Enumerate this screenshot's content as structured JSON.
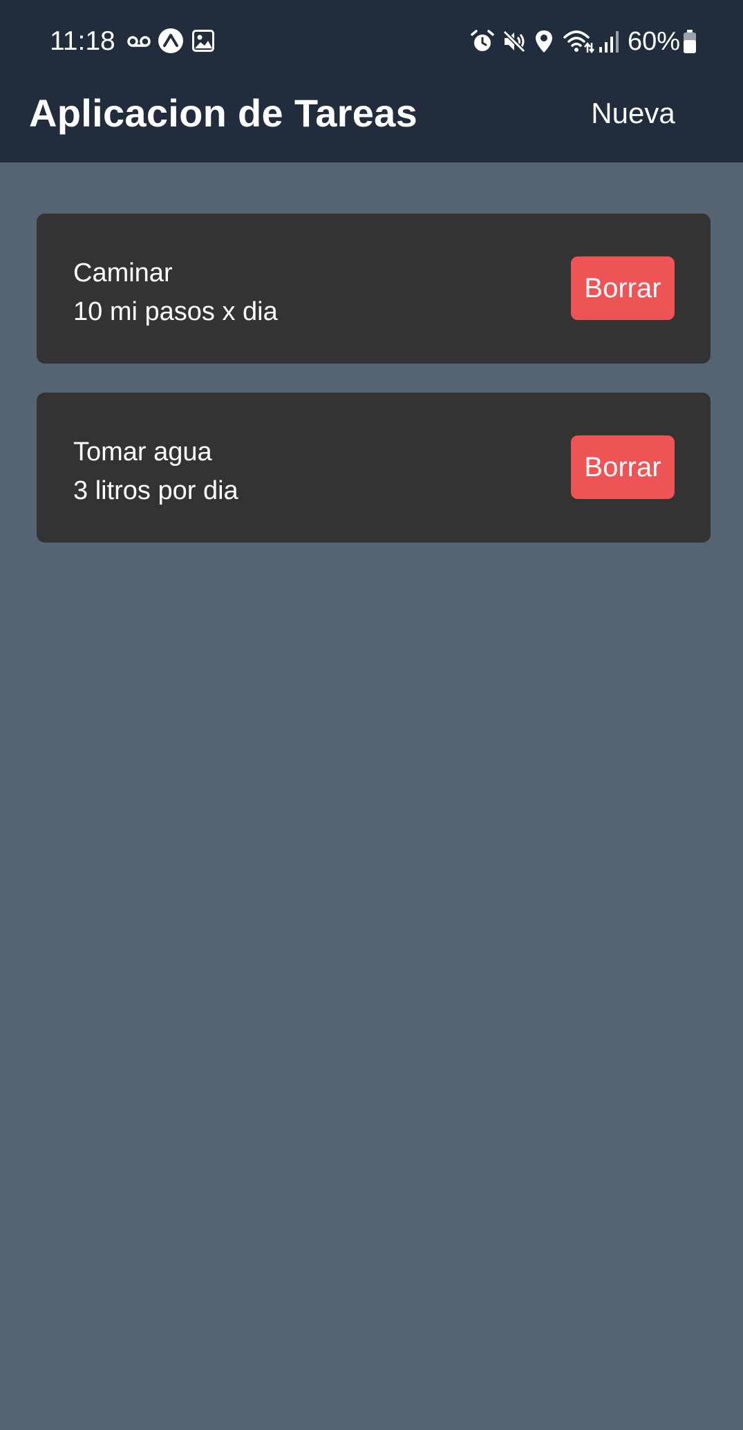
{
  "status_bar": {
    "time": "11:18",
    "battery": "60%",
    "left_icons": [
      "voicemail-icon",
      "expo-icon",
      "gallery-icon"
    ],
    "right_icons": [
      "alarm-icon",
      "mute-icon",
      "location-icon",
      "wifi-icon",
      "signal-icon",
      "battery-icon"
    ]
  },
  "header": {
    "title": "Aplicacion de Tareas",
    "new_label": "Nueva",
    "background": "#212d3d"
  },
  "tasks": [
    {
      "title": "Caminar",
      "description": "10 mi pasos x dia",
      "delete_label": "Borrar"
    },
    {
      "title": "Tomar agua",
      "description": "3 litros por dia",
      "delete_label": "Borrar"
    }
  ],
  "colors": {
    "page_background": "#556473",
    "card_background": "#333333",
    "delete_button": "#ee5456"
  }
}
